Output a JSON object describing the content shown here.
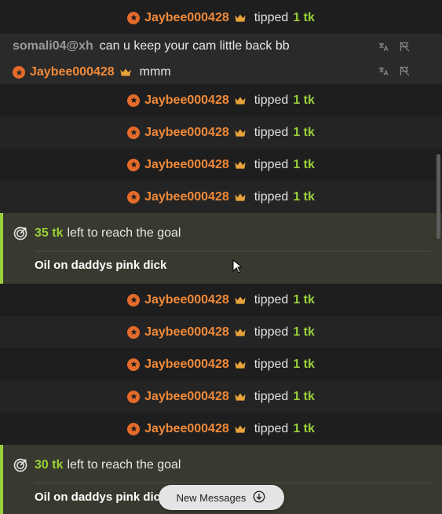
{
  "tip_text": "tipped",
  "tips": [
    {
      "user": "Jaybee000428",
      "amount": "1 tk"
    },
    {
      "user": "Jaybee000428",
      "amount": "1 tk"
    },
    {
      "user": "Jaybee000428",
      "amount": "1 tk"
    },
    {
      "user": "Jaybee000428",
      "amount": "1 tk"
    },
    {
      "user": "Jaybee000428",
      "amount": "1 tk"
    },
    {
      "user": "Jaybee000428",
      "amount": "1 tk"
    },
    {
      "user": "Jaybee000428",
      "amount": "1 tk"
    },
    {
      "user": "Jaybee000428",
      "amount": "1 tk"
    },
    {
      "user": "Jaybee000428",
      "amount": "1 tk"
    },
    {
      "user": "Jaybee000428",
      "amount": "1 tk"
    }
  ],
  "chat": [
    {
      "sender": "somali04@xh",
      "text": "can u keep your cam little back bb"
    },
    {
      "sender": "Jaybee000428",
      "text": "mmm"
    }
  ],
  "goals": [
    {
      "amount": "35 tk",
      "text": "left to reach the goal",
      "description": "Oil on daddys pink dick"
    },
    {
      "amount": "30 tk",
      "text": "left to reach the goal",
      "description": "Oil on daddys pink dick"
    }
  ],
  "new_messages_label": "New Messages",
  "colors": {
    "accent_green": "#9ad13a",
    "username_orange": "#f08a3a"
  }
}
